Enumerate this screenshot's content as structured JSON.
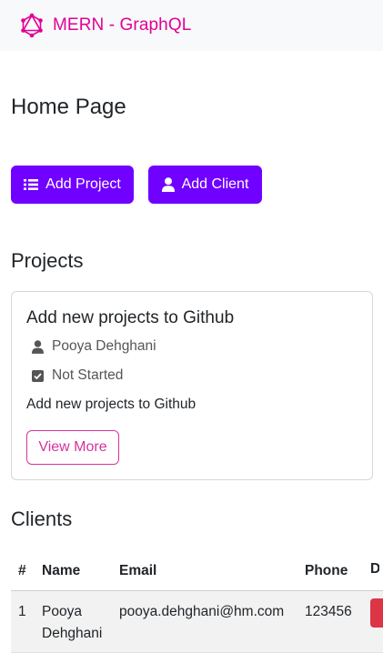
{
  "navbar": {
    "brand": "MERN - GraphQL",
    "brand_color": "#e10098"
  },
  "page": {
    "title": "Home Page"
  },
  "actions": {
    "add_project_label": "Add Project",
    "add_project_icon": "list-icon",
    "add_client_label": "Add Client",
    "add_client_icon": "user-icon",
    "accent_color": "#7000ff"
  },
  "projects": {
    "title": "Projects",
    "items": [
      {
        "name": "Add new projects to Github",
        "owner": "Pooya Dehghani",
        "status": "Not Started",
        "description": "Add new projects to Github",
        "view_label": "View More"
      }
    ]
  },
  "clients": {
    "title": "Clients",
    "columns": [
      "#",
      "Name",
      "Email",
      "Phone",
      "D"
    ],
    "rows": [
      {
        "num": "1",
        "name": "Pooya Dehghani",
        "email": "pooya.dehghani@hm.com",
        "phone": "123456"
      }
    ],
    "delete_color": "#dc3545"
  }
}
